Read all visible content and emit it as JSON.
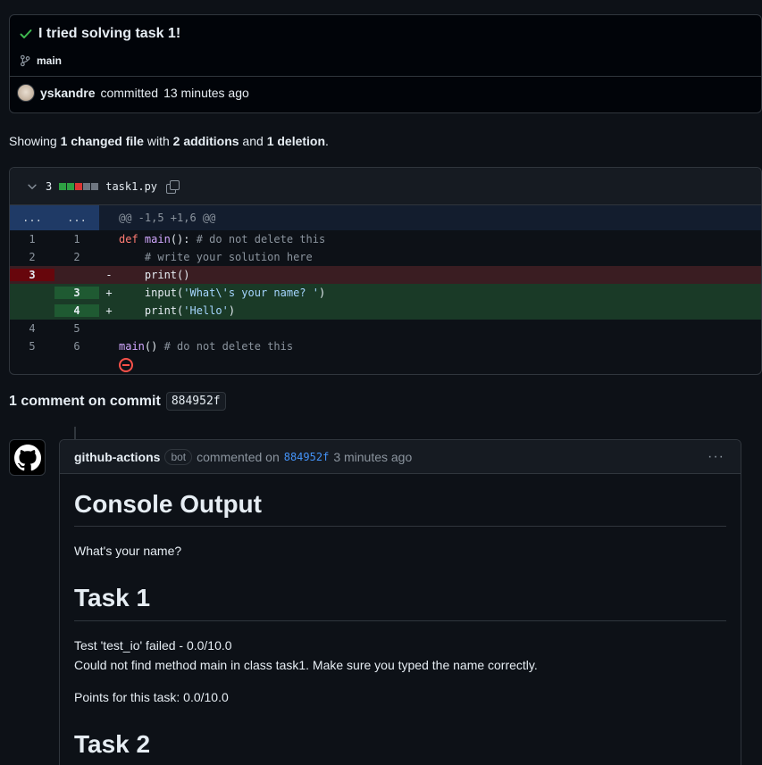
{
  "commit": {
    "title": "I tried solving task 1!",
    "branch": "main",
    "author": "yskandre",
    "action": "committed",
    "time": "13 minutes ago"
  },
  "summary": {
    "prefix": "Showing ",
    "changed": "1 changed file",
    "mid1": " with ",
    "additions": "2 additions",
    "mid2": " and ",
    "deletions": "1 deletion",
    "suffix": "."
  },
  "diff": {
    "count": "3",
    "filename": "task1.py",
    "hunk_header": "@@ -1,5 +1,6 @@",
    "hunk_ln": "...",
    "rows": [
      {
        "old": "1",
        "new": "1",
        "sign": "",
        "type": "ctx"
      },
      {
        "old": "2",
        "new": "2",
        "sign": "",
        "type": "ctx"
      },
      {
        "old": "3",
        "new": "",
        "sign": "-",
        "type": "del"
      },
      {
        "old": "",
        "new": "3",
        "sign": "+",
        "type": "add"
      },
      {
        "old": "",
        "new": "4",
        "sign": "+",
        "type": "add"
      },
      {
        "old": "4",
        "new": "5",
        "sign": "",
        "type": "ctx"
      },
      {
        "old": "5",
        "new": "6",
        "sign": "",
        "type": "ctx"
      }
    ],
    "code": {
      "l1_def": "def",
      "l1_fn": "main",
      "l1_rest": "(): ",
      "l1_cm": "# do not delete this",
      "l2": "    # write your solution here",
      "l3": "    print()",
      "l4_a": "    input(",
      "l4_str": "'What\\'s your name? '",
      "l4_b": ")",
      "l5_a": "    print(",
      "l5_str": "'Hello'",
      "l5_b": ")",
      "l7_fn": "main",
      "l7_rest": "() ",
      "l7_cm": "# do not delete this"
    }
  },
  "comments": {
    "heading": "1 comment on commit",
    "sha": "884952f"
  },
  "comment": {
    "author": "github-actions",
    "badge": "bot",
    "action": "commented on",
    "sha": "884952f",
    "time": "3 minutes ago",
    "more": "···",
    "h_console": "Console Output",
    "console_text": "What's your name?",
    "h_task1": "Task 1",
    "task1_line1": "Test 'test_io' failed - 0.0/10.0",
    "task1_line2": "Could not find method main in class task1. Make sure you typed the name correctly.",
    "task1_points": "Points for this task: 0.0/10.0",
    "h_task2": "Task 2"
  },
  "colors": {
    "success": "#3fb950",
    "addition": "#2ea043",
    "deletion": "#da3633",
    "link": "#4493f8"
  }
}
